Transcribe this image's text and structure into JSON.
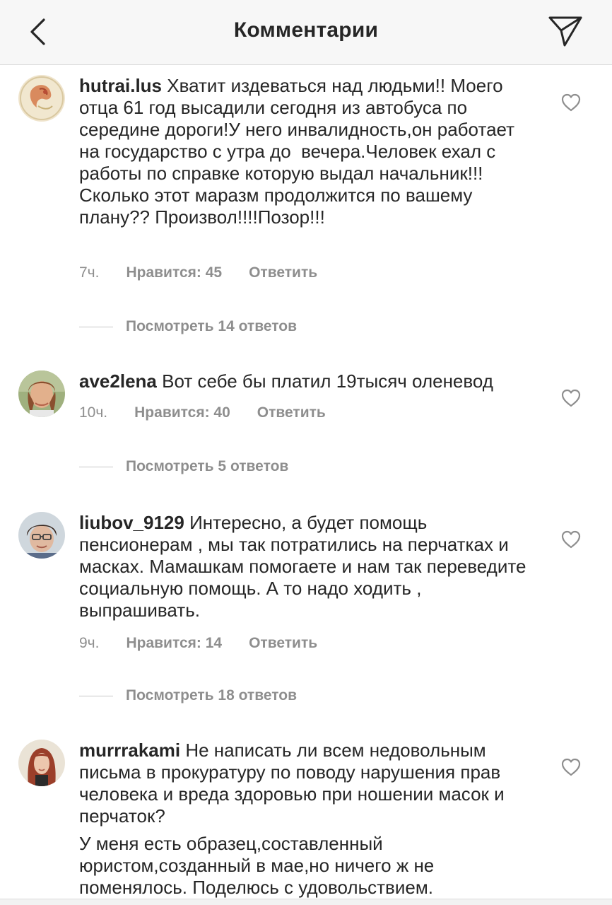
{
  "header": {
    "title": "Комментарии",
    "back_icon": "chevron-left-icon",
    "share_icon": "paper-plane-icon"
  },
  "comments": [
    {
      "username": "hutrai.lus",
      "text": "Хватит издеваться над людьми!! Моего отца 61 год высадили сегодня из автобуса по середине дороги!У него инвалидность,он работает на государство с утра до  вечера.Человек ехал с работы по справке которую выдал начальник!!!Сколько этот маразм продолжится по вашему плану?? Произвол!!!!Позор!!!",
      "time": "7ч.",
      "likes": "Нравится: 45",
      "reply": "Ответить",
      "view_replies": "Посмотреть 14 ответов"
    },
    {
      "username": "ave2lena",
      "text": "Вот себе бы платил 19тысяч оленевод",
      "time": "10ч.",
      "likes": "Нравится: 40",
      "reply": "Ответить",
      "view_replies": "Посмотреть 5 ответов"
    },
    {
      "username": "liubov_9129",
      "text": "Интересно, а будет помощь пенсионерам , мы так потратились на перчатках и масках. Мамашкам помогаете и нам так переведите социальную помощь. А то надо ходить , выпрашивать.",
      "time": "9ч.",
      "likes": "Нравится: 14",
      "reply": "Ответить",
      "view_replies": "Посмотреть 18 ответов"
    },
    {
      "username": "murrrakami",
      "text": "Не написать ли всем недовольным письма в прокуратуру по поводу нарушения прав человека и вреда здоровью при ношении масок и перчаток?",
      "text2": "У меня есть образец,составленный юристом,созданный в мае,но ничего ж не поменялось. Поделюсь с удовольствием."
    }
  ],
  "colors": {
    "text": "#262626",
    "secondary": "#8e8e8e",
    "header_bg": "#f7f7f7",
    "divider": "#dbdbdb"
  }
}
